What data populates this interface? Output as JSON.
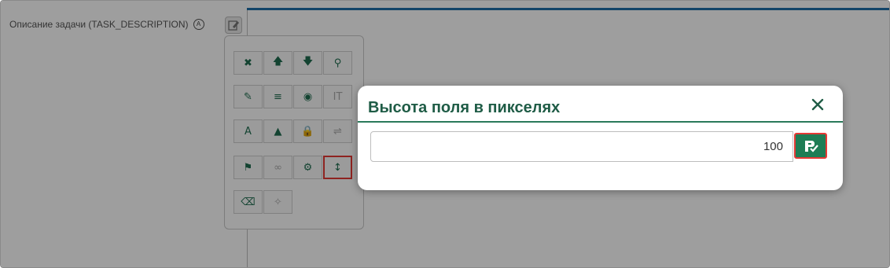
{
  "field": {
    "label": "Описание задачи (TASK_DESCRIPTION)",
    "badge": "A"
  },
  "toolbar": {
    "rows": [
      [
        {
          "icon": "close-icon",
          "glyph": "✖"
        },
        {
          "icon": "arrow-up-icon",
          "glyph": "🡅"
        },
        {
          "icon": "arrow-down-icon",
          "glyph": "🡇"
        },
        {
          "icon": "binoculars-icon",
          "glyph": "⚲"
        }
      ],
      [
        {
          "icon": "pencil-icon",
          "glyph": "✎"
        },
        {
          "icon": "list-icon",
          "glyph": "≡"
        },
        {
          "icon": "eye-slash-icon",
          "glyph": "◉"
        },
        {
          "icon": "text-height-icon",
          "glyph": "IT",
          "disabled": true
        }
      ],
      [
        {
          "icon": "font-color-icon",
          "glyph": "A"
        },
        {
          "icon": "warning-icon",
          "glyph": "▲"
        },
        {
          "icon": "lock-icon",
          "glyph": "🔒"
        },
        {
          "icon": "wrap-text-icon",
          "glyph": "⇌",
          "disabled": true
        }
      ],
      [
        {
          "icon": "flag-icon",
          "glyph": "⚑"
        },
        {
          "icon": "link-icon",
          "glyph": "∞",
          "disabled": true
        },
        {
          "icon": "gear-icon",
          "glyph": "⚙"
        },
        {
          "icon": "resize-vertical-icon",
          "glyph": "↕",
          "highlight": true
        }
      ],
      [
        {
          "icon": "eraser-icon",
          "glyph": "⌫"
        },
        {
          "icon": "magic-wand-icon",
          "glyph": "✧",
          "disabled": true
        }
      ]
    ]
  },
  "dialog": {
    "title": "Высота поля в пикселях",
    "value": "100",
    "colors": {
      "accent": "#1e7d55",
      "title": "#1f5c46",
      "highlight": "#e53935"
    }
  }
}
